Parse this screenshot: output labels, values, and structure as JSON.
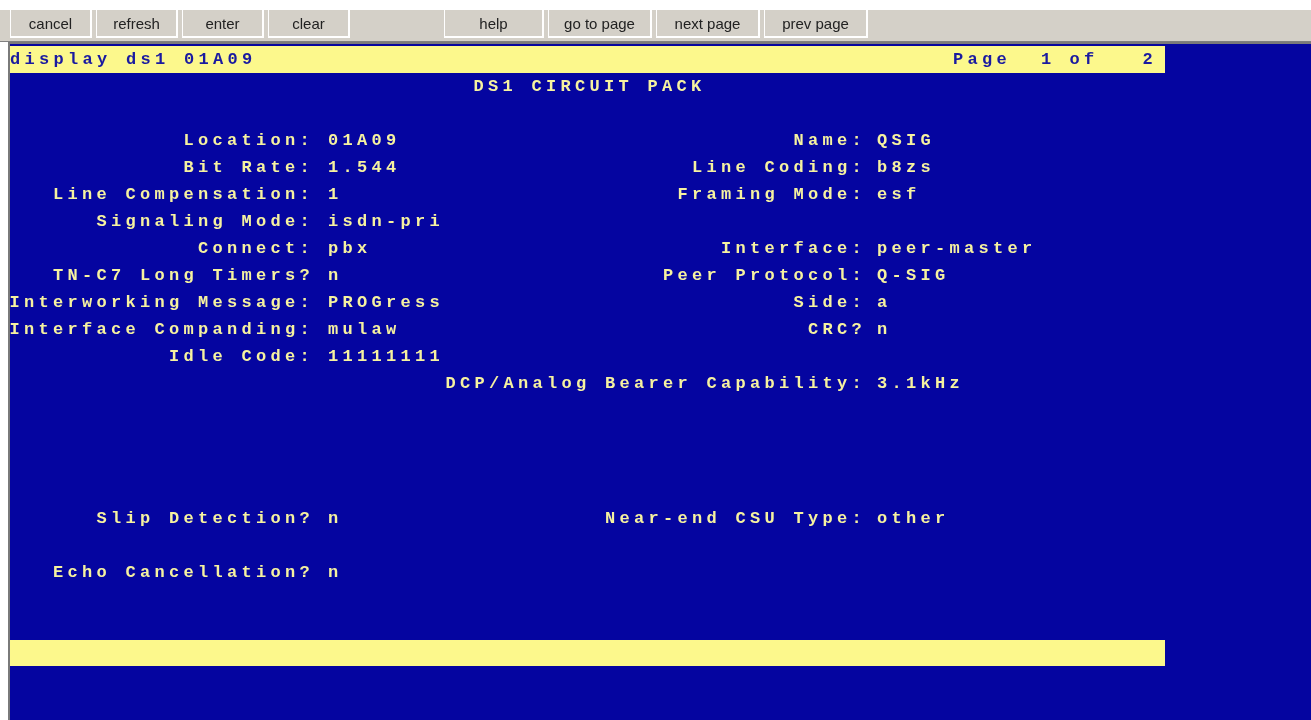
{
  "toolbar": {
    "buttons": [
      "cancel",
      "refresh",
      "enter",
      "clear",
      "help",
      "go to page",
      "next page",
      "prev page"
    ]
  },
  "command_bar": {
    "command": "display ds1 01A09",
    "page_label": "Page",
    "page": "1",
    "of": "of",
    "page_total": "2"
  },
  "form": {
    "title": "DS1 CIRCUIT PACK",
    "rows": [
      {
        "left": {
          "label": "Location:",
          "value": "01A09"
        },
        "right": {
          "label": "Name:",
          "value": "QSIG"
        }
      },
      {
        "left": {
          "label": "Bit Rate:",
          "value": "1.544"
        },
        "right": {
          "label": "Line Coding:",
          "value": "b8zs"
        }
      },
      {
        "left": {
          "label": "Line Compensation:",
          "value": "1"
        },
        "right": {
          "label": "Framing Mode:",
          "value": "esf"
        }
      },
      {
        "left": {
          "label": "Signaling Mode:",
          "value": "isdn-pri"
        }
      },
      {
        "left": {
          "label": "Connect:",
          "value": "pbx"
        },
        "right": {
          "label": "Interface:",
          "value": "peer-master"
        }
      },
      {
        "left": {
          "label": "TN-C7 Long Timers?",
          "value": "n"
        },
        "right": {
          "label": "Peer Protocol:",
          "value": "Q-SIG"
        }
      },
      {
        "left": {
          "label": "Interworking Message:",
          "value": "PROGress"
        },
        "right": {
          "label": "Side:",
          "value": "a"
        }
      },
      {
        "left": {
          "label": "Interface Companding:",
          "value": "mulaw"
        },
        "right": {
          "label": "CRC?",
          "value": "n"
        }
      },
      {
        "left": {
          "label": "Idle Code:",
          "value": "11111111"
        }
      },
      {
        "right": {
          "label": "DCP/Analog Bearer Capability:",
          "value": "3.1kHz"
        }
      },
      {
        "left": {
          "label": "Slip Detection?",
          "value": "n"
        },
        "right": {
          "label": "Near-end CSU Type:",
          "value": "other"
        }
      },
      {
        "left": {
          "label": "Echo Cancellation?",
          "value": "n"
        }
      }
    ]
  }
}
